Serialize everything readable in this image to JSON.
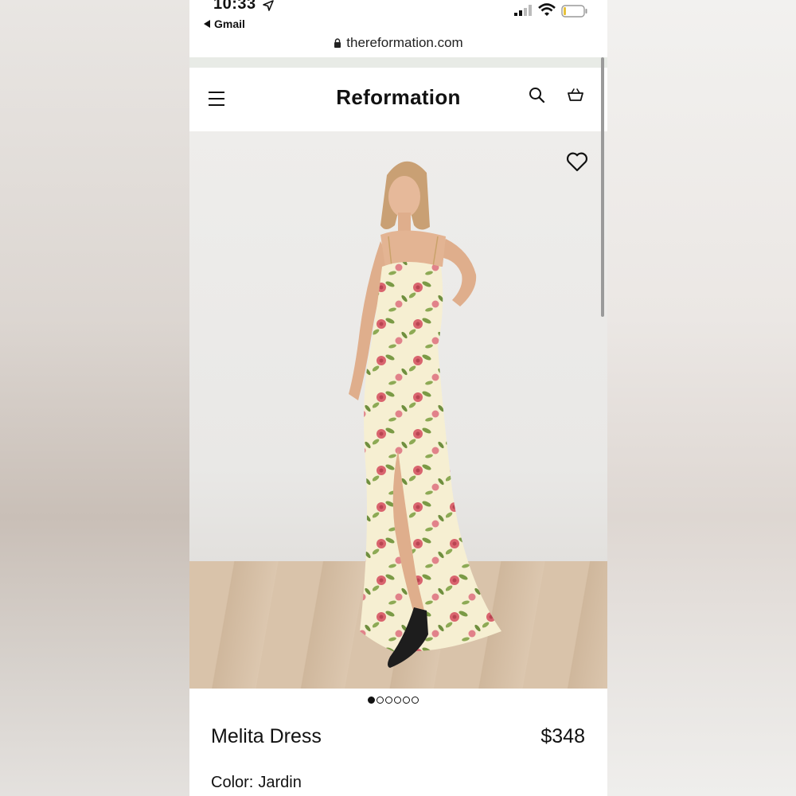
{
  "status_bar": {
    "time": "10:33",
    "back_app": "Gmail"
  },
  "browser": {
    "url": "thereformation.com"
  },
  "header": {
    "brand": "Reformation",
    "menu_icon": "hamburger-menu-icon",
    "search_icon": "search-icon",
    "bag_icon": "shopping-bag-icon"
  },
  "product": {
    "name": "Melita Dress",
    "price": "$348",
    "color_label": "Color:",
    "color_value": "Jardin",
    "image_count": 6,
    "active_image": 1
  },
  "colors": {
    "text": "#111111",
    "dress_base": "#f6efd2",
    "flower": "#d9646e",
    "leaf": "#7a9a45"
  }
}
